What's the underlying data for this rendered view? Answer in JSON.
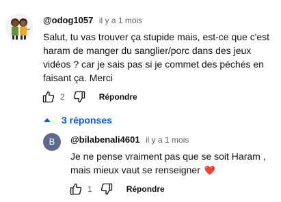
{
  "comment": {
    "author": "@odog1057",
    "timestamp": "il y a 1 mois",
    "text": "Salut, tu vas trouver ça stupide mais, est-ce que c'est haram de manger du sanglier/porc dans des jeux vidéos ? car je sais pas si je commet des péchés en faisant ça. Merci",
    "like_count": "2",
    "reply_label": "Répondre",
    "avatar_icon": "cartoon-avatar-icon"
  },
  "replies_toggle": {
    "label": "3 réponses",
    "color": "#065fd4"
  },
  "reply": {
    "avatar_letter": "B",
    "avatar_color": "#5c6b8c",
    "author": "@bilabenali4601",
    "timestamp": "il y a 1 mois",
    "text": "Je ne pense vraiment pas que se soit Haram , mais mieux vaut se renseigner",
    "emoji": "❤️",
    "like_count": "1",
    "reply_label": "Répondre"
  }
}
